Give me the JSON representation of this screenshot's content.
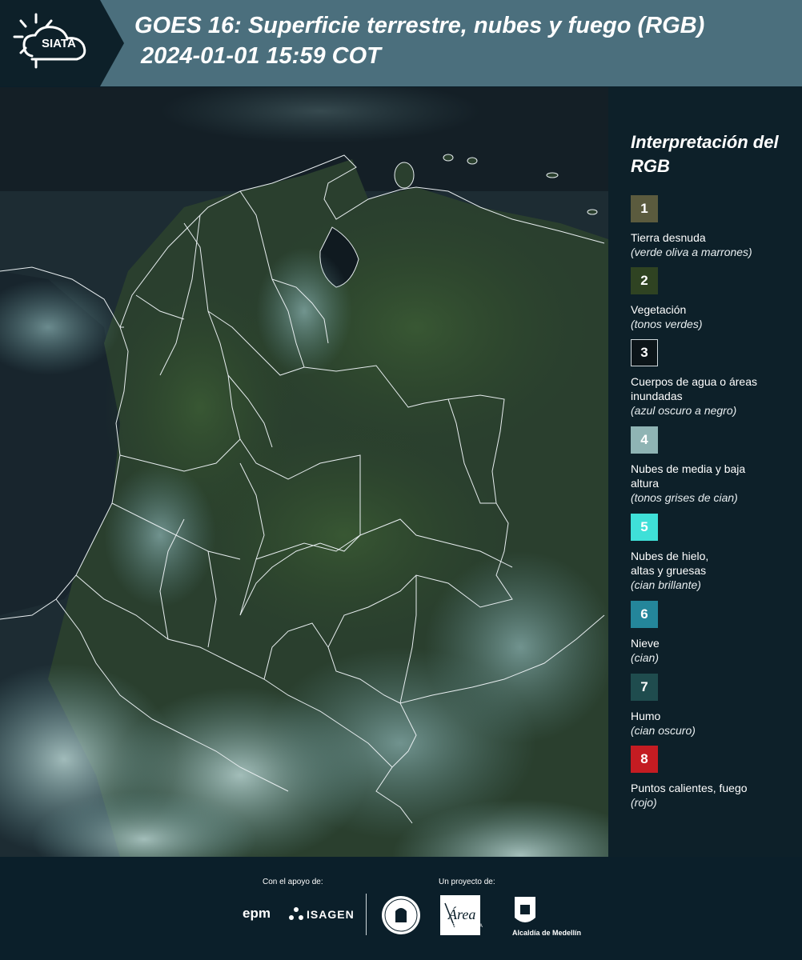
{
  "header": {
    "logo_text": "SIATA",
    "title": "GOES 16: Superficie terrestre, nubes y fuego (RGB)",
    "datetime": "2024-01-01 15:59 COT"
  },
  "legend": {
    "title": "Interpretación del RGB",
    "items": [
      {
        "number": "1",
        "label": "Tierra desnuda",
        "desc": "(verde oliva a marrones)",
        "color": "#5b5b3e"
      },
      {
        "number": "2",
        "label": "Vegetación",
        "desc": "(tonos verdes)",
        "color": "#2f4322"
      },
      {
        "number": "3",
        "label": "Cuerpos de agua o áreas inundadas",
        "desc": "(azul oscuro a negro)",
        "color": "#0c1519"
      },
      {
        "number": "4",
        "label": "Nubes de media y baja altura",
        "desc": "(tonos grises de cian)",
        "color": "#8fb4b4"
      },
      {
        "number": "5",
        "label": "Nubes de hielo, altas y gruesas",
        "desc": "(cian brillante)",
        "color": "#3fe0d8"
      },
      {
        "number": "6",
        "label": "Nieve",
        "desc": "(cian)",
        "color": "#24869a"
      },
      {
        "number": "7",
        "label": "Humo",
        "desc": "(cian oscuro)",
        "color": "#1f4c4e"
      },
      {
        "number": "8",
        "label": "Puntos calientes, fuego",
        "desc": "(rojo)",
        "color": "#c41c22"
      }
    ]
  },
  "footer": {
    "support_label": "Con el apoyo de:",
    "project_label": "Un proyecto de:",
    "epm": "epm",
    "isagen": "ISAGEN",
    "metropolitana": "METROPOLITANA",
    "alcaldia": "Alcaldía de Medellín"
  }
}
